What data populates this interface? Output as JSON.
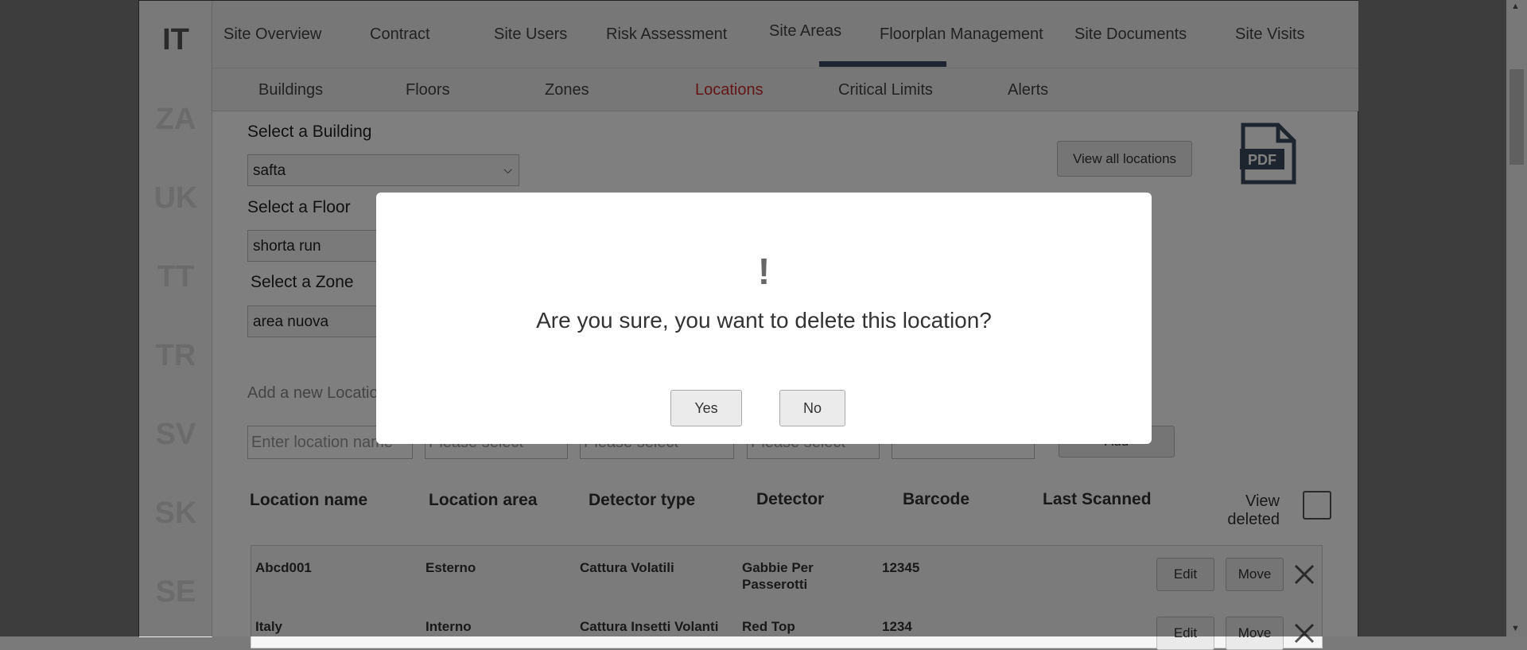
{
  "countries": [
    "IT",
    "ZA",
    "UK",
    "TT",
    "TR",
    "SV",
    "SK",
    "SE"
  ],
  "tabs": [
    "Site Overview",
    "Contract",
    "Site Users",
    "Risk Assessment",
    "Site Areas",
    "Floorplan Management",
    "Site Documents",
    "Site Visits"
  ],
  "active_tab": "Site Areas",
  "subtabs": [
    "Buildings",
    "Floors",
    "Zones",
    "Locations",
    "Critical Limits",
    "Alerts"
  ],
  "active_subtab": "Locations",
  "form": {
    "building_label": "Select a Building",
    "building_value": "safta",
    "floor_label": "Select a Floor",
    "floor_value": "shorta run",
    "zone_label": "Select a Zone",
    "zone_value": "area nuova",
    "view_all_label": "View all locations",
    "add_new_label": "Add a new Location",
    "location_name_placeholder": "Enter location name",
    "please_select": "Please select",
    "add_button": "Add",
    "pdf_icon_text": "PDF"
  },
  "table": {
    "headers": [
      "Location name",
      "Location area",
      "Detector type",
      "Detector",
      "Barcode",
      "Last Scanned"
    ],
    "view_deleted": "View deleted",
    "rows": [
      {
        "name": "Abcd001",
        "area": "Esterno",
        "detector_type": "Cattura Volatili",
        "detector": "Gabbie Per Passerotti",
        "barcode": "12345",
        "last_scanned": ""
      },
      {
        "name": "Italy",
        "area": "Interno",
        "detector_type": "Cattura Insetti Volanti",
        "detector": "Red Top",
        "barcode": "1234",
        "last_scanned": ""
      }
    ],
    "edit_label": "Edit",
    "move_label": "Move"
  },
  "modal": {
    "icon": "!",
    "message": "Are you sure, you want to delete this location?",
    "yes": "Yes",
    "no": "No"
  },
  "colors": {
    "active_subtab": "#c82b2b",
    "tab_underline": "#3c4a5c"
  }
}
